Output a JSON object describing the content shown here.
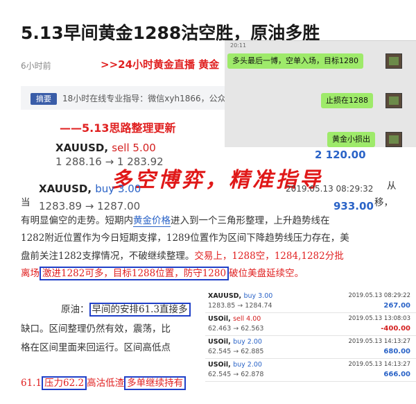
{
  "article": {
    "title": "5.13早间黄金1288沽空胜，原油多胜",
    "time_ago": "6小时前",
    "live_link": ">>24小时黄金直播 黄金"
  },
  "summary": {
    "badge": "摘要",
    "text": "18小时在线专业指导：微信xyh1866，公众"
  },
  "chat": {
    "time": "20:11",
    "messages": [
      "多头最后一博，空单入场，目标1280",
      "止损在1288",
      "黄金小损出"
    ]
  },
  "update_heading": "——5.13思路整理更新",
  "trade_sell": {
    "symbol": "XAUUSD,",
    "action": "sell 5.00",
    "price": "1 288.16 → 1 283.92",
    "profit": "2 120.00"
  },
  "slogan": "多空博弈，精准指导",
  "trade_buy": {
    "symbol": "XAUUSD,",
    "action": "buy 3.00",
    "date": "2019.05.13 08:29:32",
    "price": "1283.89 → 1287.00",
    "profit": "933.00"
  },
  "body": {
    "line1_a": "当",
    "line1_b": "从",
    "line2_a": "有明显偏空的走势。短期内",
    "line2_link": "黄金价格",
    "line2_b": "进入到一个三角形整理，上升趋势线在",
    "line2_c": "移，",
    "line3": "1282附近位置作为今日短期支撑，1289位置作为区间下降趋势线压力存在，美",
    "line4_a": "盘前关注1282支撑情况，不破继续整理。",
    "line4_red": "交易上，1288空，1284,1282分批",
    "line5_red_a": "离场",
    "line5_boxed": "激进1282可多，目标1288位置，防守1280",
    "line5_red_b": "破位美盘延续空。",
    "oil_label": "原油：",
    "oil_boxed": "早间的安排61.3直接多",
    "line7": "缺口。区间整理仍然有效，震荡，比",
    "line8": "格在区间里面来回运行。区间高低点",
    "line9_a": "61.1",
    "line9_boxed1": "压力62.2",
    "line9_b": "高沽低渣",
    "line9_boxed2": "多单继续持有"
  },
  "trade_list": [
    {
      "symbol": "XAUUSD,",
      "action": "buy 3.00",
      "price": "1283.85 → 1284.74",
      "date": "2019.05.13 08:29:22",
      "profit": "267.00",
      "negative": false
    },
    {
      "symbol": "USOil,",
      "action": "sell 4.00",
      "price": "62.463 → 62.563",
      "date": "2019.05.13 13:08:03",
      "profit": "-400.00",
      "negative": true
    },
    {
      "symbol": "USOil,",
      "action": "buy 2.00",
      "price": "62.545 → 62.885",
      "date": "2019.05.13 14:13:27",
      "profit": "680.00",
      "negative": false
    },
    {
      "symbol": "USOil,",
      "action": "buy 2.00",
      "price": "62.545 → 62.878",
      "date": "2019.05.13 14:13:27",
      "profit": "666.00",
      "negative": false
    }
  ]
}
